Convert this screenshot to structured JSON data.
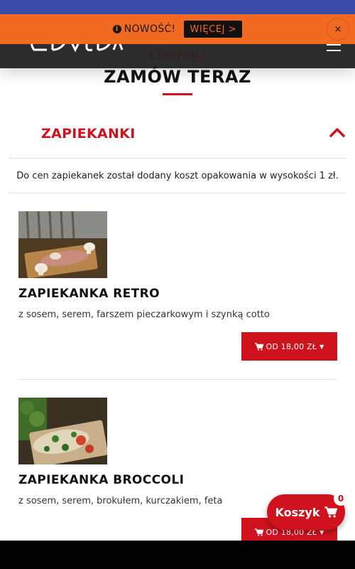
{
  "notice": {
    "text": "NOWOŚĆ!",
    "more_label": "WIĘCEJ >",
    "close_label": "×",
    "icon": "info-icon"
  },
  "header": {
    "logo_icon": "logo-icon",
    "menu_icon": "hamburger-icon"
  },
  "hero": {
    "subtitle": "Głodny?",
    "title": "ZAMÓW TERAZ"
  },
  "category": {
    "name": "ZAPIEKANKI",
    "toggle_icon": "chevron-up-icon",
    "notice": "Do cen zapiekanek został dodany koszt opakowania w wysokości 1 zł."
  },
  "products": [
    {
      "name": "ZAPIEKANKA RETRO",
      "description": "z sosem, serem, farszem pieczarkowym i szynką cotto",
      "price_label": "OD 18,00 ZŁ"
    },
    {
      "name": "ZAPIEKANKA BROCCOLI",
      "description": "z sosem, serem, brokułem, kurczakiem, feta",
      "price_label": "OD 18,00 ZŁ"
    }
  ],
  "cart": {
    "label": "Koszyk",
    "count": "0",
    "icon": "cart-icon"
  },
  "colors": {
    "accent": "#d0121f",
    "notice_bg": "#f26a21",
    "header_bg": "#2c2c2c",
    "status_bar": "#3b4ba8"
  }
}
